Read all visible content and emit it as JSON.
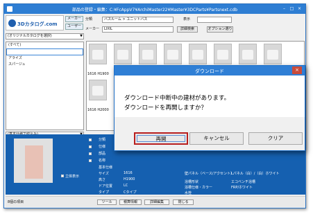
{
  "window": {
    "title": "部品の登録・編集：C:¥FcAppV7¥ArchiMaster22¥Master¥3DCParts¥Partsnext.cdb",
    "minimize": "–",
    "maximize": "□",
    "close": "×"
  },
  "left": {
    "logo_text": "3Dカタログ.com",
    "maker_button": "メーカー",
    "user_button": "ユーザー",
    "catalog_select": "(オリジナルカタログを選択)",
    "list_items": [
      "(すべて)",
      "",
      "アライズ",
      "スパージュ"
    ],
    "filter_select": "(基本仕様で絞込み)"
  },
  "toolbar": {
    "category_label": "分類",
    "category_value": "バスルーム > ユニットバス",
    "display_label": "表示",
    "maker_label": "メーカー",
    "maker_value": "LIXIL",
    "detail_search": "詳細検索",
    "option_button": "オプション選り"
  },
  "grid": {
    "captions": [
      "1616 H1900",
      "1616 H2000"
    ]
  },
  "details": {
    "labels": [
      "分類",
      "仕様",
      "部品",
      "名称",
      "基本仕様",
      "サイズ",
      "高さ",
      "ドア位置",
      "タイプ"
    ],
    "values": [
      "",
      "",
      "",
      "",
      "",
      "1616",
      "H1900",
      "LC",
      "Cタイプ"
    ],
    "show3d": "立体表示",
    "spec_labels": [
      "壁パネル（ベース/アクセント）",
      "浴槽形状",
      "浴槽形状",
      "浴槽仕様・カラー",
      "水栓"
    ],
    "spec_values": [
      "Lパネル（白）/（白）ホワイト",
      "エコベンチ浴槽",
      "",
      "FRP/ホワイト",
      ""
    ]
  },
  "dialog": {
    "title": "ダウンロード",
    "line1": "ダウンロード中断中の建材があります。",
    "line2": "ダウンロードを再開しますか？",
    "reopen": "再開",
    "cancel": "キャンセル",
    "clear": "クリア",
    "close": "×"
  },
  "status": {
    "count": "8個の項目",
    "tool": "ツール",
    "detail_info": "積算情報",
    "detail_edit": "詳細編集",
    "close": "閉じる"
  },
  "colors": {
    "titlebar": "#2e7ed3",
    "bottom_panel": "#1560b0",
    "highlight": "#b81e1e"
  }
}
